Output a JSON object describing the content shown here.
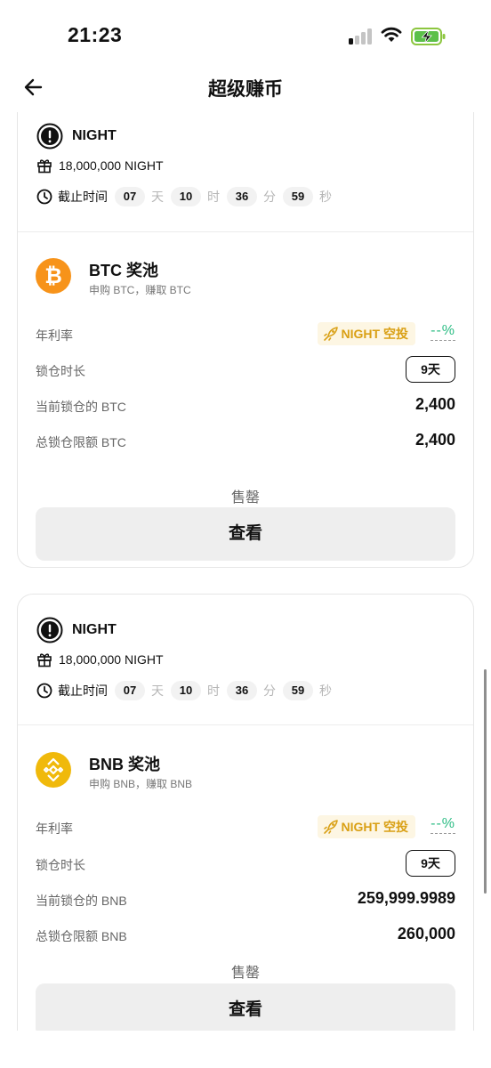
{
  "status_bar": {
    "time": "21:23"
  },
  "header": {
    "title": "超级赚币",
    "back_icon": "back-arrow-icon"
  },
  "cards": [
    {
      "airdrop": {
        "token": "NIGHT",
        "reward": "18,000,000 NIGHT",
        "deadline_label": "截止时间",
        "countdown": {
          "days": "07",
          "days_unit": "天",
          "hours": "10",
          "hours_unit": "时",
          "minutes": "36",
          "minutes_unit": "分",
          "seconds": "59",
          "seconds_unit": "秒"
        }
      },
      "pool": {
        "coin_symbol": "₿",
        "coin_color": "#f7931a",
        "title": "BTC 奖池",
        "subtitle": "申购 BTC，赚取 BTC",
        "apy_label": "年利率",
        "airdrop_tag": "NIGHT 空投",
        "apy_value": "--%",
        "lock_label": "锁仓时长",
        "lock_value": "9天",
        "current_label": "当前锁仓的 BTC",
        "current_value": "2,400",
        "total_label": "总锁仓限额 BTC",
        "total_value": "2,400",
        "status": "售罄",
        "button": "查看"
      }
    },
    {
      "airdrop": {
        "token": "NIGHT",
        "reward": "18,000,000 NIGHT",
        "deadline_label": "截止时间",
        "countdown": {
          "days": "07",
          "days_unit": "天",
          "hours": "10",
          "hours_unit": "时",
          "minutes": "36",
          "minutes_unit": "分",
          "seconds": "59",
          "seconds_unit": "秒"
        }
      },
      "pool": {
        "coin_color": "#f0b90b",
        "title": "BNB 奖池",
        "subtitle": "申购 BNB，赚取 BNB",
        "apy_label": "年利率",
        "airdrop_tag": "NIGHT 空投",
        "apy_value": "--%",
        "lock_label": "锁仓时长",
        "lock_value": "9天",
        "current_label": "当前锁仓的 BNB",
        "current_value": "259,999.9989",
        "total_label": "总锁仓限额 BNB",
        "total_value": "260,000",
        "status": "售罄",
        "button": "查看"
      }
    }
  ]
}
